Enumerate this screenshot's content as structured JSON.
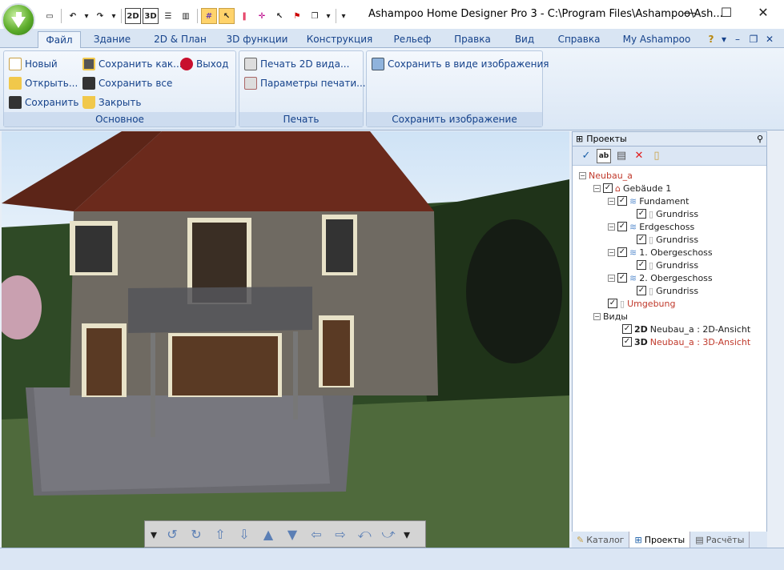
{
  "app": {
    "title": "Ashampoo Home Designer Pro 3 - C:\\Program Files\\Ashampoo\\Ash..."
  },
  "qat": {
    "btn2d": "2D",
    "btn3d": "3D"
  },
  "tabs": [
    "Файл",
    "Здание",
    "2D & План",
    "3D функции",
    "Конструкция",
    "Рельеф",
    "Правка",
    "Вид",
    "Справка",
    "My Ashampoo"
  ],
  "ribbon": {
    "basic": {
      "new": "Новый",
      "open": "Открыть...",
      "save": "Сохранить",
      "save_as": "Сохранить как...",
      "save_all": "Сохранить все",
      "close": "Закрыть",
      "exit": "Выход",
      "caption": "Основное"
    },
    "print": {
      "print2d": "Печать 2D вида...",
      "print_params": "Параметры печати...",
      "caption": "Печать"
    },
    "image": {
      "save_image": "Сохранить в виде изображения",
      "caption": "Сохранить изображение"
    }
  },
  "panel": {
    "title": "Проекты",
    "tree": {
      "root": "Neubau_a",
      "building": "Gebäude 1",
      "fundament": "Fundament",
      "grundriss": "Grundriss",
      "erdgeschoss": "Erdgeschoss",
      "og1": "1. Obergeschoss",
      "og2": "2. Obergeschoss",
      "umgebung": "Umgebung",
      "views": "Виды",
      "view2d_tag": "2D",
      "view2d": "Neubau_a : 2D-Ansicht",
      "view3d_tag": "3D",
      "view3d": "Neubau_a : 3D-Ansicht"
    },
    "tabs": {
      "catalog": "Каталог",
      "projects": "Проекты",
      "calc": "Расчёты"
    }
  },
  "colors": {
    "accent": "#15428b",
    "highlight": "#c0392b"
  }
}
